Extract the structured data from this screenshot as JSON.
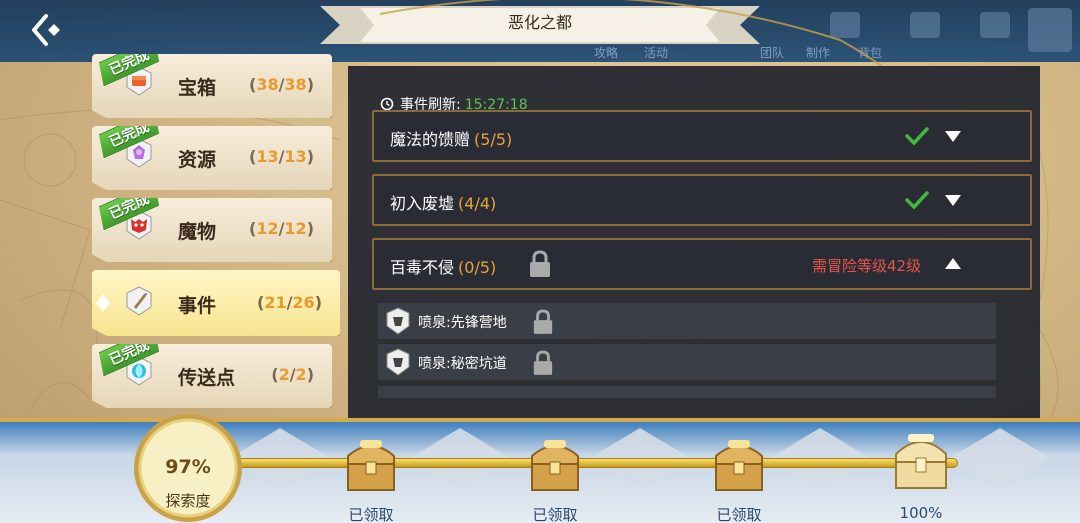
{
  "header": {
    "title": "恶化之都",
    "ghost_labels": [
      "攻略",
      "活动",
      "团队",
      "制作",
      "背包"
    ]
  },
  "categories": [
    {
      "name": "宝箱",
      "done": "38",
      "total": "38",
      "completed": true,
      "badge": "已完成",
      "icon": "chest-icon"
    },
    {
      "name": "资源",
      "done": "13",
      "total": "13",
      "completed": true,
      "badge": "已完成",
      "icon": "crystal-icon"
    },
    {
      "name": "魔物",
      "done": "12",
      "total": "12",
      "completed": true,
      "badge": "已完成",
      "icon": "monster-icon"
    },
    {
      "name": "事件",
      "done": "21",
      "total": "26",
      "completed": false,
      "badge": "",
      "icon": "quill-icon"
    },
    {
      "name": "传送点",
      "done": "2",
      "total": "2",
      "completed": true,
      "badge": "已完成",
      "icon": "portal-icon"
    }
  ],
  "panel": {
    "refresh_label": "事件刷新:",
    "refresh_time": "15:27:18",
    "quests": [
      {
        "name": "魔法的馈赠",
        "count": "(5/5)",
        "status": "completed"
      },
      {
        "name": "初入废墟",
        "count": "(4/4)",
        "status": "completed"
      },
      {
        "name": "百毒不侵",
        "count": "(0/5)",
        "status": "locked",
        "requirement": "需冒险等级42级"
      }
    ],
    "sub_items": [
      {
        "name": "喷泉:先锋营地",
        "locked": true
      },
      {
        "name": "喷泉:秘密坑道",
        "locked": true
      }
    ]
  },
  "progress": {
    "explore_value": "97%",
    "explore_label": "探索度",
    "fill_fraction": 0.97,
    "milestones": [
      {
        "label": "已领取"
      },
      {
        "label": "已领取"
      },
      {
        "label": "已领取"
      },
      {
        "label": "100%"
      }
    ]
  },
  "colors": {
    "accent_gold": "#e6a634",
    "complete_green": "#58c94f",
    "warning_red": "#e8544a",
    "panel_bg": "#21252d"
  }
}
